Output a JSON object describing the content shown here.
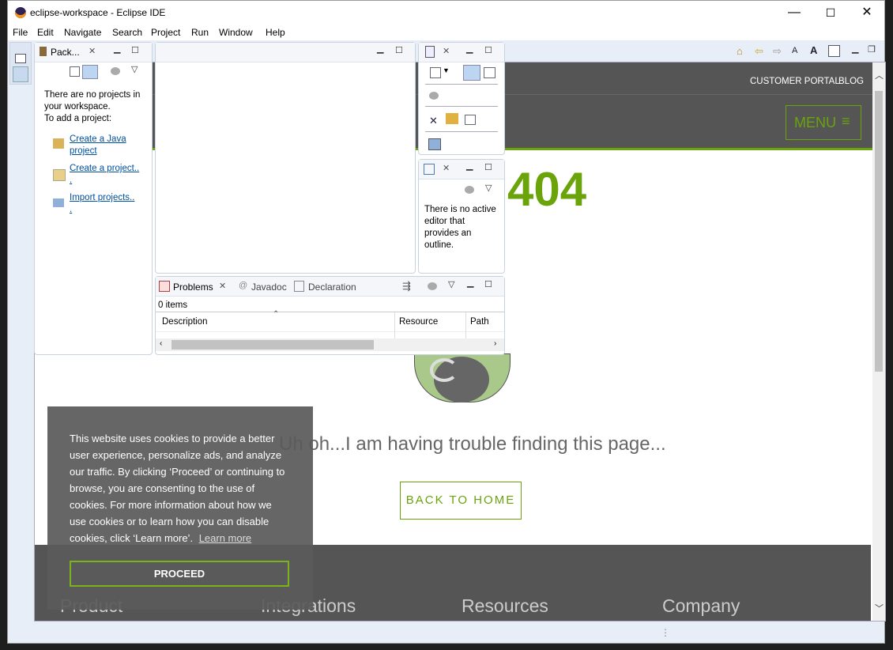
{
  "window": {
    "title": "eclipse-workspace - Eclipse IDE",
    "min": "—",
    "max": "☐",
    "close": "✕"
  },
  "menu": [
    "File",
    "Edit",
    "Navigate",
    "Search",
    "Project",
    "Run",
    "Window",
    "Help"
  ],
  "package_explorer": {
    "tab": "Pack...",
    "intro": [
      "There are no projects in",
      "your workspace.",
      "To add a project:"
    ],
    "links": [
      {
        "label1": "Create a Java ",
        "label2": "project"
      },
      {
        "label1": "Create a project..",
        "label2": "."
      },
      {
        "label1": "Import projects..",
        "label2": "."
      }
    ]
  },
  "outline": {
    "message": [
      "There is no active",
      "editor that",
      "provides an",
      "outline."
    ]
  },
  "problems": {
    "tabs": [
      "Problems",
      "Javadoc",
      "Declaration"
    ],
    "count": "0 items",
    "columns": [
      "Description",
      "Resource",
      "Path"
    ]
  },
  "web": {
    "top_links": [
      "CUSTOMER PORTAL",
      "BLOG"
    ],
    "menu": "MENU",
    "error_code": "404",
    "message": "Uh oh...I am having trouble finding this page...",
    "back_home": "BACK TO HOME",
    "footer_cols": [
      "Product",
      "Integrations",
      "Resources",
      "Company"
    ],
    "cookie": {
      "text": "This website uses cookies to provide a better user experience, personalize ads, and analyze our traffic. By clicking ‘Proceed’ or continuing to browse, you are consenting to the use of cookies. For more information about how we use cookies or to learn how you can disable cookies, click ‘Learn more’.",
      "learn_more": "Learn more",
      "proceed": "PROCEED"
    },
    "accent": "#6aa40a"
  }
}
